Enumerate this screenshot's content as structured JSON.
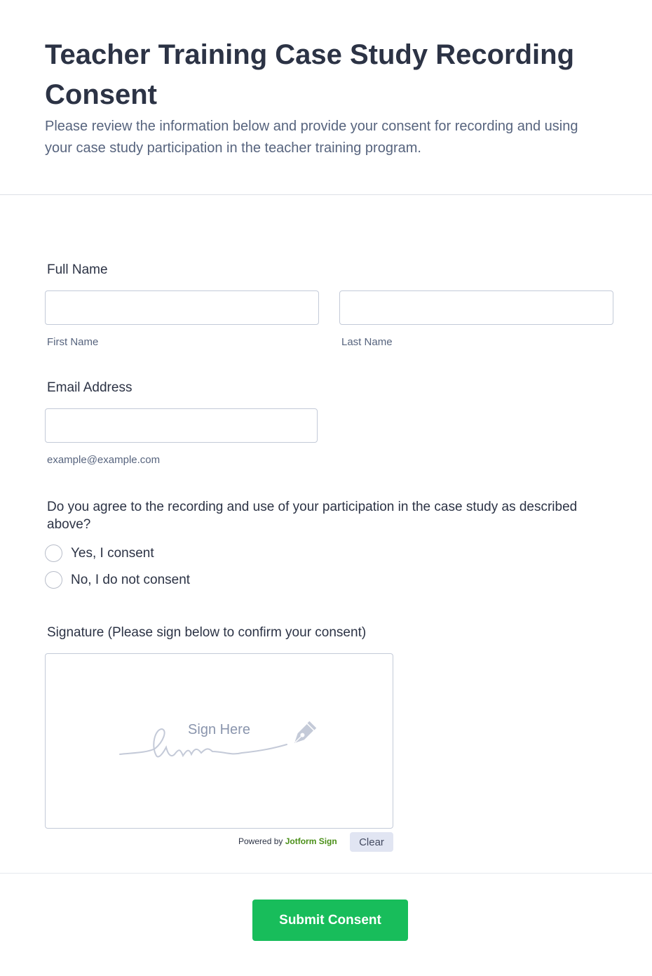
{
  "header": {
    "title": "Teacher Training Case Study Recording Consent",
    "subtitle": "Please review the information below and provide your consent for recording and using your case study participation in the teacher training program."
  },
  "full_name": {
    "label": "Full Name",
    "first_value": "",
    "first_sublabel": "First Name",
    "last_value": "",
    "last_sublabel": "Last Name"
  },
  "email": {
    "label": "Email Address",
    "value": "",
    "sublabel": "example@example.com"
  },
  "consent": {
    "question": "Do you agree to the recording and use of your participation in the case study as described above?",
    "options": [
      "Yes, I consent",
      "No, I do not consent"
    ]
  },
  "signature": {
    "label": "Signature (Please sign below to confirm your consent)",
    "placeholder": "Sign Here",
    "powered_prefix": "Powered by",
    "powered_brand": "Jotform Sign",
    "clear_label": "Clear"
  },
  "submit": {
    "label": "Submit Consent"
  },
  "colors": {
    "submit": "#18bd5b",
    "brand_green": "#4a8f18",
    "text": "#2c3345",
    "muted": "#57647e"
  }
}
